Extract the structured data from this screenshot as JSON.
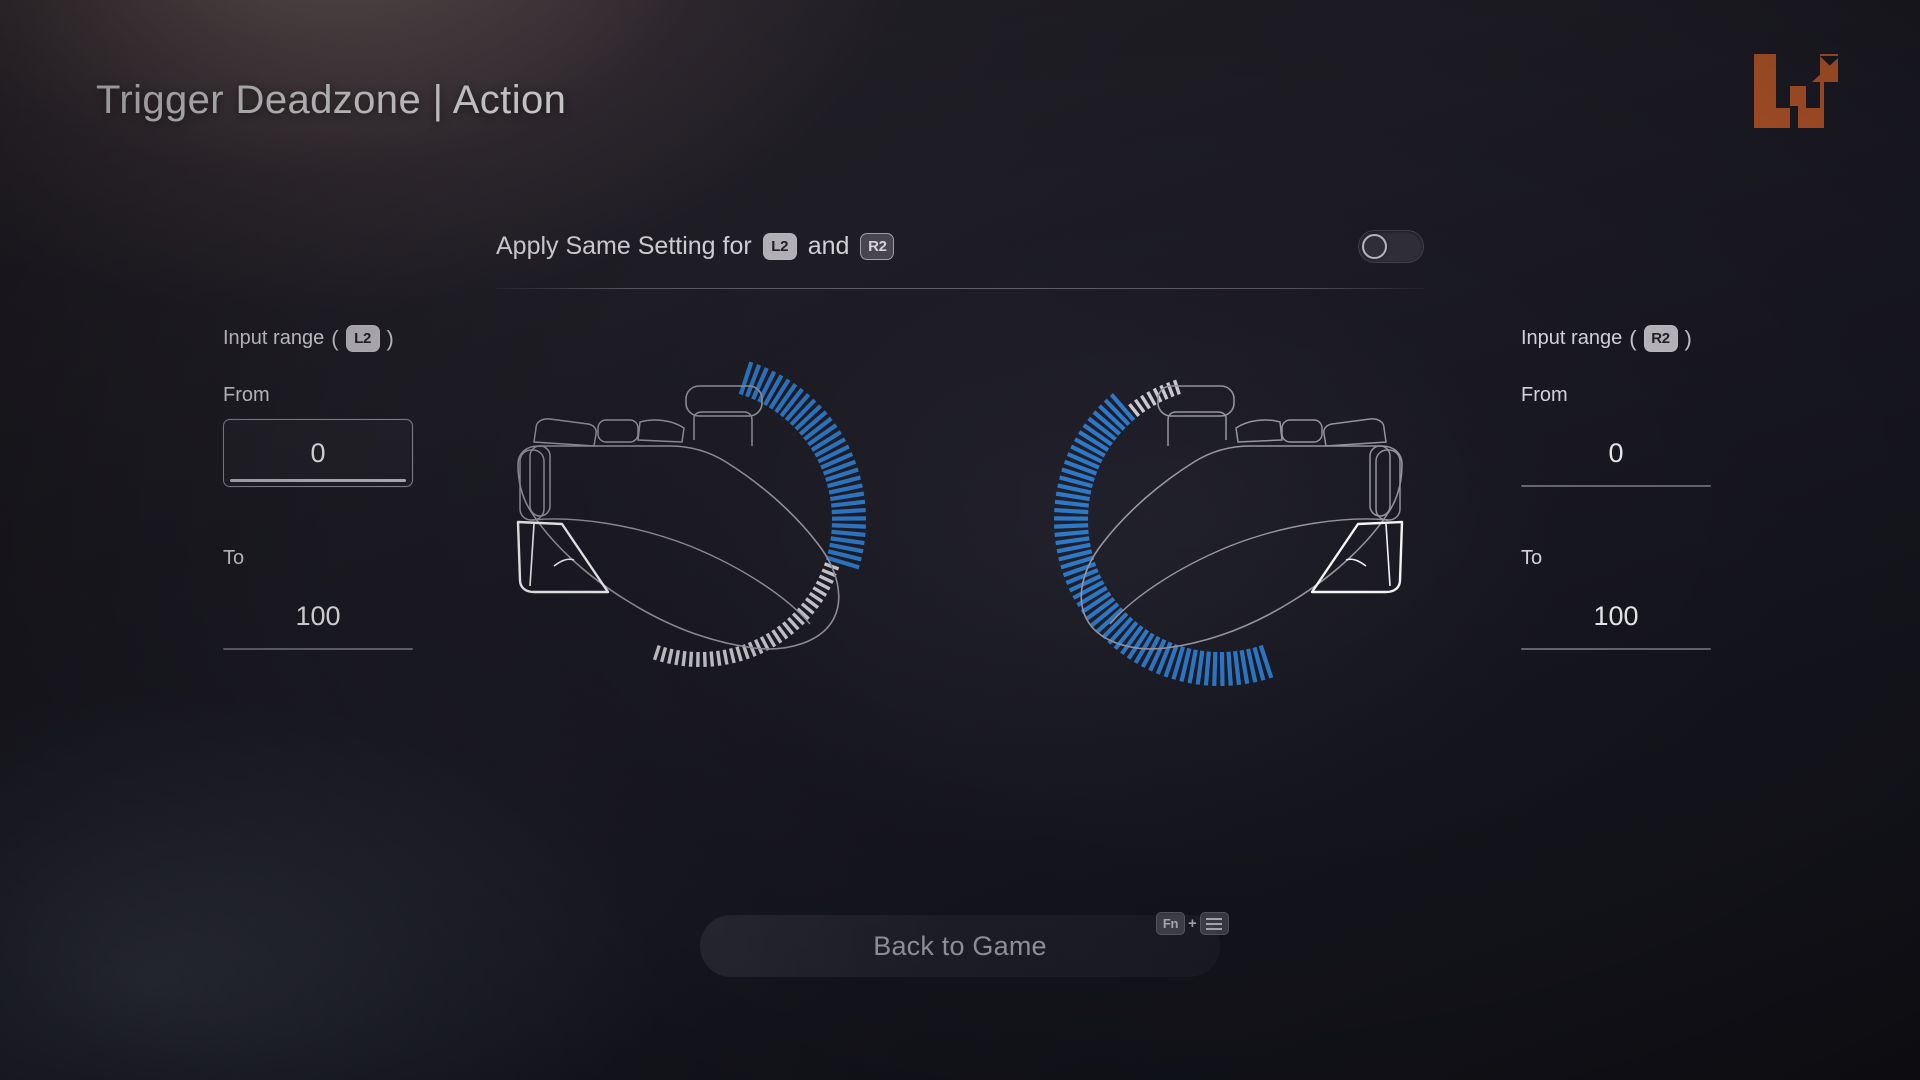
{
  "header": {
    "title": "Trigger Deadzone | Action",
    "logo_icon": "wootility-w-logo-icon",
    "logo_color": "#b8582a"
  },
  "apply_same": {
    "label_prefix": "Apply Same Setting for",
    "left_button": "L2",
    "conjunction": "and",
    "right_button": "R2",
    "toggle_state": "off"
  },
  "left_panel": {
    "heading_text": "Input range",
    "heading_button": "L2",
    "paren_open": "(",
    "paren_close": ")",
    "from_label": "From",
    "from_value": "0",
    "to_label": "To",
    "to_value": "100",
    "focused_field": "from"
  },
  "right_panel": {
    "heading_text": "Input range",
    "heading_button": "R2",
    "paren_open": "(",
    "paren_close": ")",
    "from_label": "From",
    "from_value": "0",
    "to_label": "To",
    "to_value": "100",
    "focused_field": "none"
  },
  "graphic": {
    "left_gauge": {
      "label": "L2 trigger deadzone gauge",
      "active_color": "#2f7fd4",
      "inactive_color": "#e9e9ee",
      "active_pct": 50
    },
    "right_gauge": {
      "label": "R2 trigger deadzone gauge",
      "active_color": "#2f7fd4",
      "inactive_color": "#e9e9ee",
      "active_pct": 88
    },
    "controller_outline_color": "#9a99a4",
    "trigger_highlight_color": "#ffffff"
  },
  "footer": {
    "back_label": "Back to Game",
    "hint_key": "Fn",
    "hint_plus": "+",
    "hint_icon": "menu-icon"
  }
}
